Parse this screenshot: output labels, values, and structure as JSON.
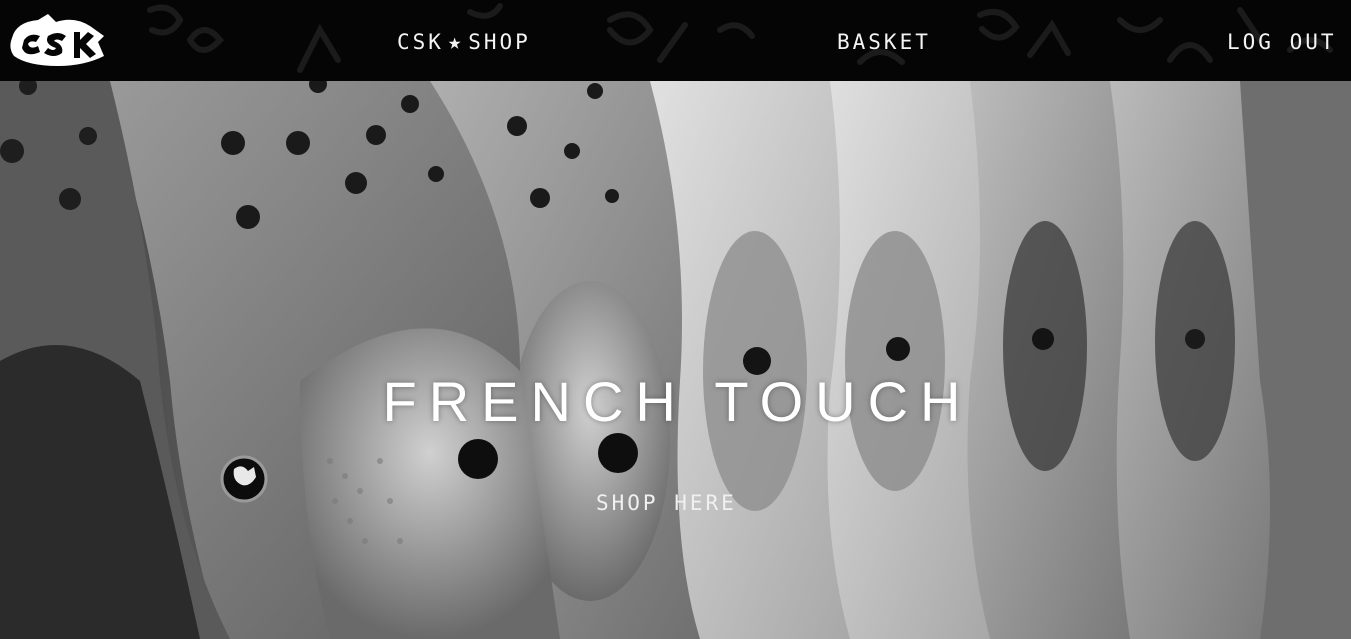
{
  "brand": {
    "logo_text": "CSK",
    "accent": "#000000"
  },
  "nav": {
    "shop_prefix": "CSK",
    "shop_icon": "star-icon",
    "shop_suffix": "SHOP",
    "basket": "BASKET",
    "logout": "LOG OUT"
  },
  "hero": {
    "title": "FRENCH TOUCH",
    "cta": "SHOP HERE",
    "image": "grayscale-clogs-on-rack"
  },
  "colors": {
    "navbar_bg": "#050505",
    "text": "#ffffff"
  }
}
